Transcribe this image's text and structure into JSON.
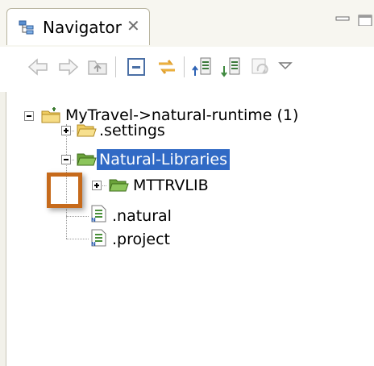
{
  "view": {
    "tab_title": "Navigator",
    "tab_close_glyph": "✕",
    "icon": "navigator-icon"
  },
  "toolbar": {
    "items": [
      {
        "name": "back-icon"
      },
      {
        "name": "forward-icon"
      },
      {
        "name": "up-folder-icon"
      },
      {
        "name": "collapse-all-icon"
      },
      {
        "name": "link-with-editor-icon"
      },
      {
        "name": "sort-up-icon"
      },
      {
        "name": "sort-down-icon"
      },
      {
        "name": "refresh-icon"
      },
      {
        "name": "view-menu-icon"
      }
    ]
  },
  "tree": {
    "root": {
      "label": "MyTravel->natural-runtime (1)",
      "expanded": true,
      "icon": "project-folder-icon"
    },
    "items": [
      {
        "label": ".settings",
        "icon": "folder-icon",
        "expanded": false
      },
      {
        "label": "Natural-Libraries",
        "icon": "folder-icon",
        "expanded": true,
        "selected": true
      },
      {
        "label": "MTTRVLIB",
        "icon": "folder-icon",
        "expanded": false
      },
      {
        "label": ".natural",
        "icon": "natural-file-icon"
      },
      {
        "label": ".project",
        "icon": "natural-file-icon"
      }
    ]
  },
  "colors": {
    "selection": "#316ac5",
    "highlight": "#c66a1b",
    "folder": "#e8c75a"
  }
}
